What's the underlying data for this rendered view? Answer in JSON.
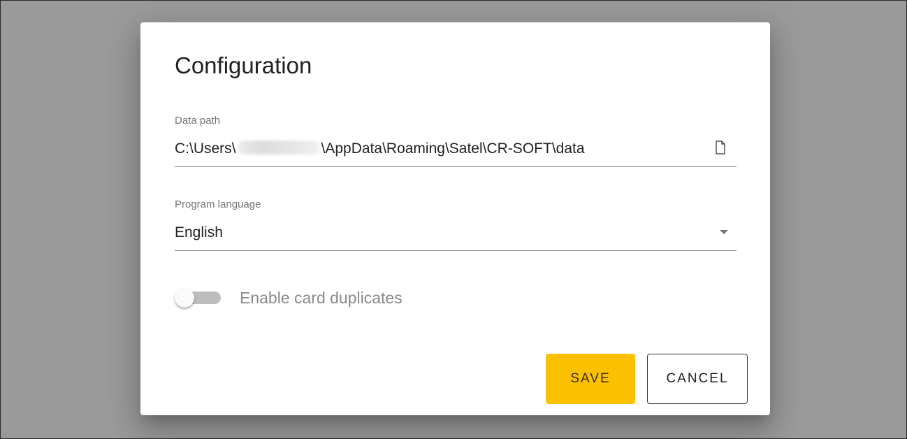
{
  "dialog": {
    "title": "Configuration",
    "data_path": {
      "label": "Data path",
      "value_prefix": "C:\\Users\\",
      "value_suffix": "\\AppData\\Roaming\\Satel\\CR-SOFT\\data",
      "icon": "file-icon"
    },
    "program_language": {
      "label": "Program language",
      "selected": "English",
      "icon": "dropdown-arrow-icon"
    },
    "card_duplicates": {
      "label": "Enable card duplicates",
      "enabled": false
    },
    "buttons": {
      "save_label": "SAVE",
      "cancel_label": "CANCEL"
    }
  },
  "colors": {
    "backdrop": "#9a9a9a",
    "save_button": "#fbc100",
    "text_primary": "#212121",
    "text_secondary": "#757575"
  }
}
